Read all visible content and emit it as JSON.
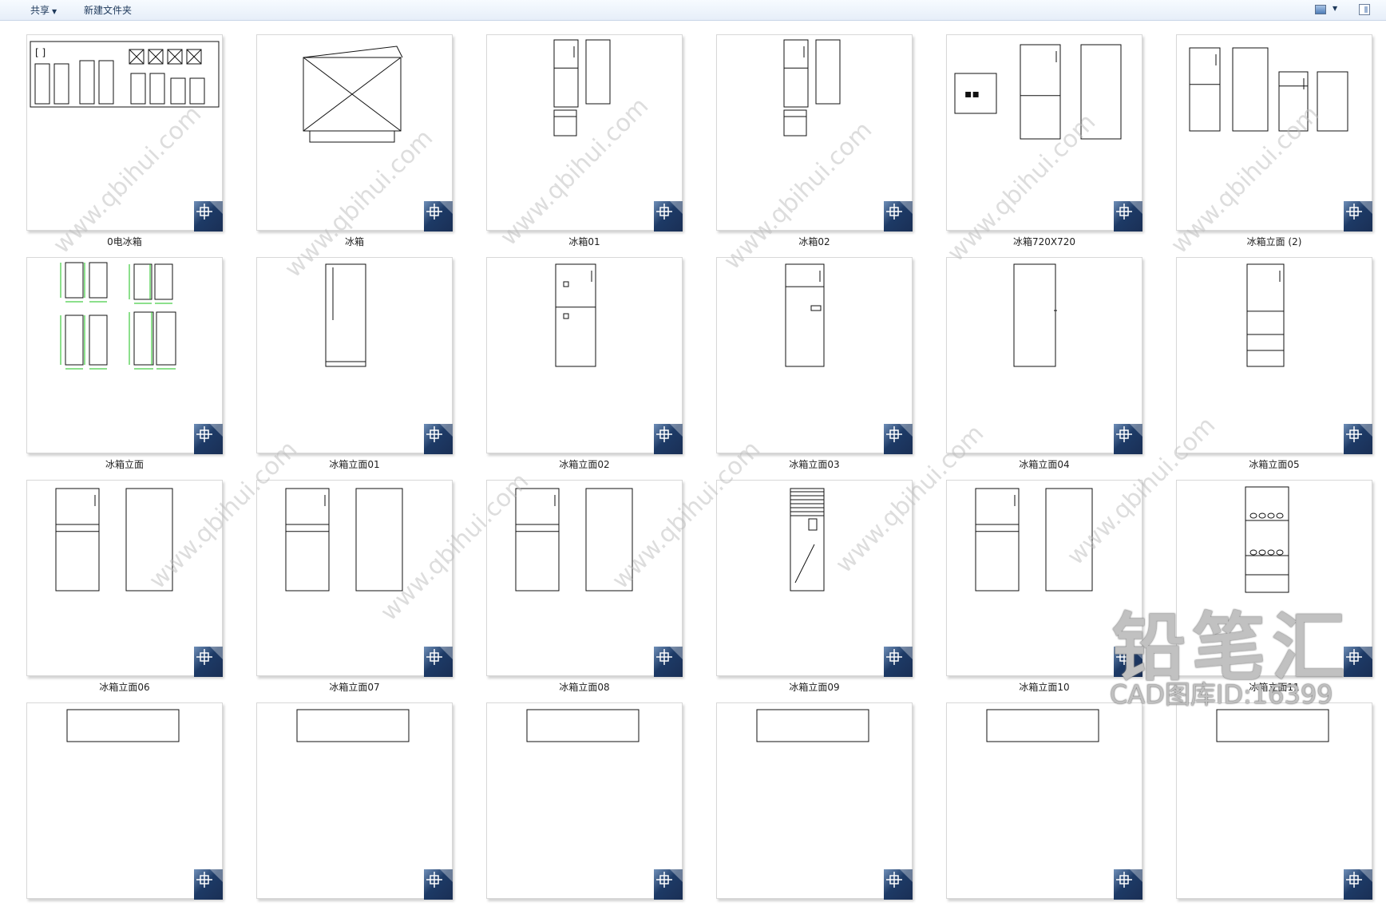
{
  "toolbar": {
    "share_label": "共享",
    "new_folder_label": "新建文件夹"
  },
  "files": [
    {
      "name": "0电冰箱",
      "drawing": "collection"
    },
    {
      "name": "冰箱",
      "drawing": "chest"
    },
    {
      "name": "冰箱01",
      "drawing": "two-fridges-small"
    },
    {
      "name": "冰箱02",
      "drawing": "two-fridges-small"
    },
    {
      "name": "冰箱720X720",
      "drawing": "box-and-fridges"
    },
    {
      "name": "冰箱立面 (2)",
      "drawing": "four-fridges"
    },
    {
      "name": "冰箱立面",
      "drawing": "dimensioned-fridges"
    },
    {
      "name": "冰箱立面01",
      "drawing": "single-fridge"
    },
    {
      "name": "冰箱立面02",
      "drawing": "single-fridge-panels"
    },
    {
      "name": "冰箱立面03",
      "drawing": "single-fridge-handle"
    },
    {
      "name": "冰箱立面04",
      "drawing": "single-fridge-plain"
    },
    {
      "name": "冰箱立面05",
      "drawing": "fridge-drawers"
    },
    {
      "name": "冰箱立面06",
      "drawing": "front-and-side"
    },
    {
      "name": "冰箱立面07",
      "drawing": "front-and-side"
    },
    {
      "name": "冰箱立面08",
      "drawing": "front-and-side"
    },
    {
      "name": "冰箱立面09",
      "drawing": "narrow-cabinet"
    },
    {
      "name": "冰箱立面10",
      "drawing": "front-and-side"
    },
    {
      "name": "冰箱立面11",
      "drawing": "wine-cabinet"
    },
    {
      "name": "",
      "drawing": "partial"
    },
    {
      "name": "",
      "drawing": "partial"
    },
    {
      "name": "",
      "drawing": "partial"
    },
    {
      "name": "",
      "drawing": "partial"
    },
    {
      "name": "",
      "drawing": "partial"
    },
    {
      "name": "",
      "drawing": "partial"
    }
  ],
  "watermark": {
    "site": "www.qbihui.com",
    "brand": "铅笔汇",
    "id_text": "CAD图库ID:16399"
  },
  "colors": {
    "toolbar_text": "#1e395b",
    "badge_dark": "#1d3a66",
    "dimension_green": "#19c019"
  }
}
